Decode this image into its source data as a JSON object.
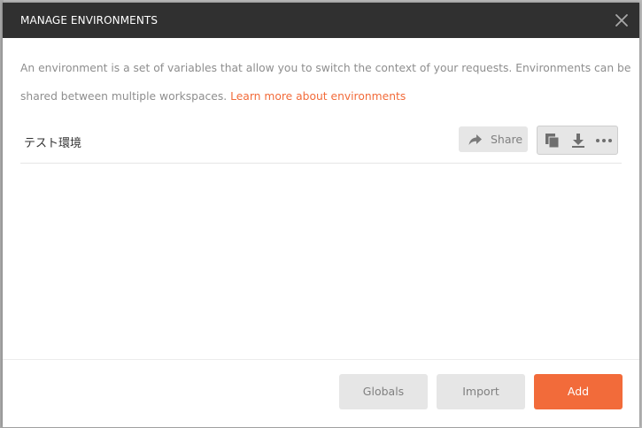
{
  "header": {
    "title": "MANAGE ENVIRONMENTS",
    "close_icon": "close-icon"
  },
  "description": {
    "text": "An environment is a set of variables that allow you to switch the context of your requests. Environments can be shared between multiple workspaces.",
    "link_text": "Learn more about environments"
  },
  "environments": [
    {
      "name": "テスト環境",
      "share_label": "Share",
      "share_icon": "share-arrow-icon",
      "actions": [
        "duplicate-icon",
        "download-icon",
        "more-icon"
      ]
    }
  ],
  "footer": {
    "globals_label": "Globals",
    "import_label": "Import",
    "add_label": "Add"
  },
  "colors": {
    "header_bg": "#303030",
    "accent": "#f26b3a",
    "button_bg": "#e6e6e6",
    "muted_text": "#8e8e8e"
  }
}
